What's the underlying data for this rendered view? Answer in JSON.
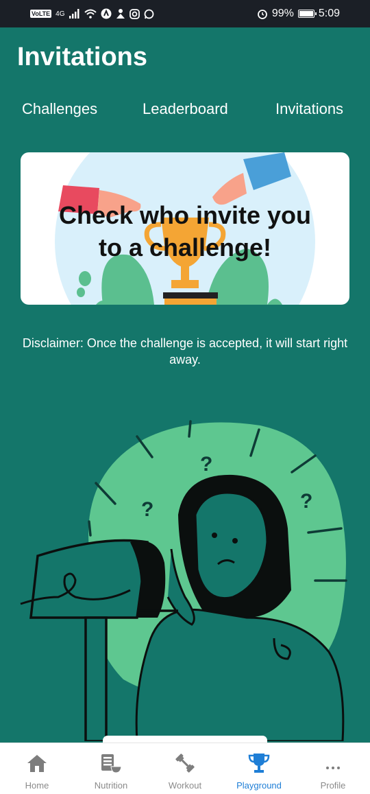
{
  "status_bar": {
    "volte": "VoLTE",
    "network": "4G",
    "battery_text": "99%",
    "battery_level": 0.99,
    "time": "5:09"
  },
  "header": {
    "title": "Invitations"
  },
  "tabs": [
    {
      "label": "Challenges"
    },
    {
      "label": "Leaderboard"
    },
    {
      "label": "Invitations"
    }
  ],
  "banner": {
    "text_line1": "Check who invite you",
    "text_line2": "to a challenge!"
  },
  "disclaimer": "Disclaimer: Once the challenge is accepted, it will start right away.",
  "bottom_nav": {
    "items": [
      {
        "label": "Home",
        "icon": "home-icon"
      },
      {
        "label": "Nutrition",
        "icon": "nutrition-icon"
      },
      {
        "label": "Workout",
        "icon": "dumbbell-icon"
      },
      {
        "label": "Playground",
        "icon": "trophy-icon",
        "active": true
      },
      {
        "label": "Profile",
        "icon": "more-icon"
      }
    ]
  },
  "colors": {
    "background": "#14766a",
    "status_bar": "#1b1f26",
    "accent_active": "#1e7ed6",
    "illustration_green": "#5ec790"
  }
}
